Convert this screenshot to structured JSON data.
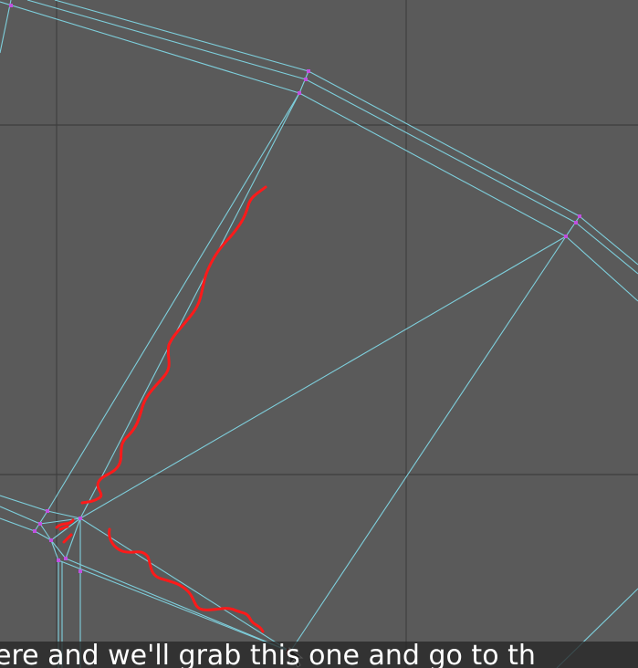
{
  "caption": {
    "text": "ere and we'll grab this one and go to th"
  },
  "colors": {
    "background": "#5a5a5a",
    "grid_line": "#3f3f3f",
    "wire_edge": "#7ecfdc",
    "vertex": "#c050e0",
    "annotation_stroke": "#ff1a1a",
    "caption_bg": "#262626",
    "caption_text": "#ffffff"
  },
  "viewport": {
    "name": "modeling-viewport-orthographic",
    "selection_tool": "vertex-select"
  }
}
